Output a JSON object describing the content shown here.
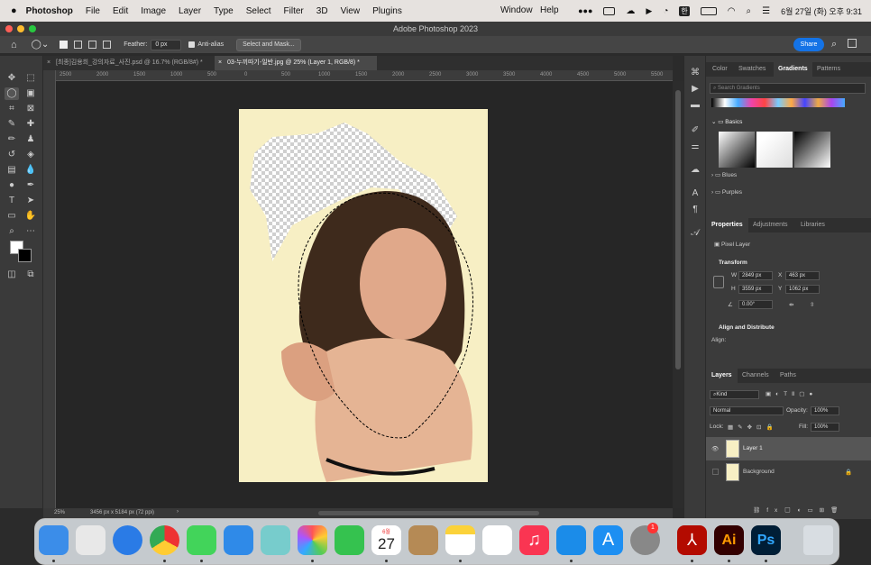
{
  "menubar": {
    "app": "Photoshop",
    "items": [
      "File",
      "Edit",
      "Image",
      "Layer",
      "Type",
      "Select",
      "Filter",
      "3D",
      "View",
      "Plugins"
    ],
    "window": "Window",
    "help": "Help",
    "clock": "6월 27일 (화) 오후 9:31",
    "lang": "한"
  },
  "title": "Adobe Photoshop 2023",
  "options": {
    "feather_label": "Feather:",
    "feather_value": "0 px",
    "antialias": "Anti-alias",
    "select_mask": "Select and Mask...",
    "share": "Share"
  },
  "tabs": [
    {
      "label": "[최종]김용희_강의자료_사진.psd @ 16.7% (RGB/8#) *"
    },
    {
      "label": "03-누끼따기-일반.jpg @ 25% (Layer 1, RGB/8) *"
    }
  ],
  "ruler": [
    "2500",
    "2000",
    "1500",
    "1000",
    "500",
    "0",
    "500",
    "1000",
    "1500",
    "2000",
    "2500",
    "3000",
    "3500",
    "4000",
    "4500",
    "5000",
    "5500"
  ],
  "status": {
    "zoom": "25%",
    "size": "3456 px x 5184 px (72 ppi)"
  },
  "gradients_panel": {
    "tabs": [
      "Color",
      "Swatches",
      "Gradients",
      "Patterns"
    ],
    "search": "Search Gradients",
    "folders": [
      "Basics",
      "Blues",
      "Purples"
    ]
  },
  "properties": {
    "tabs": [
      "Properties",
      "Adjustments",
      "Libraries"
    ],
    "kind": "Pixel Layer",
    "transform": "Transform",
    "w_label": "W",
    "w": "2849 px",
    "x_label": "X",
    "x": "463 px",
    "h_label": "H",
    "h": "3559 px",
    "y_label": "Y",
    "y": "1062 px",
    "angle": "0.00°",
    "align": "Align and Distribute",
    "align_label": "Align:"
  },
  "layers": {
    "tabs": [
      "Layers",
      "Channels",
      "Paths"
    ],
    "kind": "Kind",
    "blend": "Normal",
    "opacity_label": "Opacity:",
    "opacity": "100%",
    "lock_label": "Lock:",
    "fill_label": "Fill:",
    "fill": "100%",
    "items": [
      {
        "name": "Layer 1"
      },
      {
        "name": "Background"
      }
    ]
  },
  "dock": {
    "calendar_month": "6월",
    "calendar_day": "27",
    "badge": "1",
    "ai": "Ai",
    "ps": "Ps"
  },
  "colors": {
    "accent": "#1473e6",
    "canvas_bg": "#f7efc4",
    "selection": "#000000"
  }
}
